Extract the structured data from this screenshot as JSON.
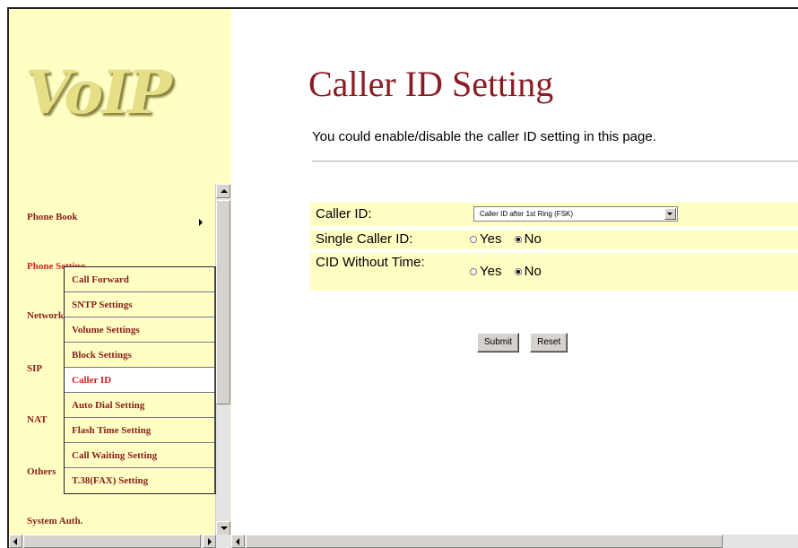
{
  "logo": {
    "text": "VoIP"
  },
  "sidebar": {
    "items": [
      {
        "label": "Phone Book"
      },
      {
        "label": "Phone Setting"
      },
      {
        "label": "Network"
      },
      {
        "label": "SIP"
      },
      {
        "label": "NAT"
      },
      {
        "label": "Others"
      },
      {
        "label": "System Auth."
      }
    ],
    "submenu": [
      {
        "label": "Call Forward"
      },
      {
        "label": "SNTP Settings"
      },
      {
        "label": "Volume Settings"
      },
      {
        "label": "Block Settings"
      },
      {
        "label": "Caller ID"
      },
      {
        "label": "Auto Dial Setting"
      },
      {
        "label": "Flash Time Setting"
      },
      {
        "label": "Call Waiting Setting"
      },
      {
        "label": "T.38(FAX) Setting"
      }
    ]
  },
  "main": {
    "title": "Caller ID Setting",
    "description": "You could enable/disable the caller ID setting in this page.",
    "form": {
      "caller_id_label": "Caller ID:",
      "caller_id_value": "Caller ID after 1st Ring (FSK)",
      "single_caller_id_label": "Single Caller ID:",
      "cid_without_time_label": "CID Without Time:",
      "yes_label": "Yes",
      "no_label": "No",
      "single_caller_id_selected": "No",
      "cid_without_time_selected": "No"
    },
    "submit_label": "Submit",
    "reset_label": "Reset"
  }
}
